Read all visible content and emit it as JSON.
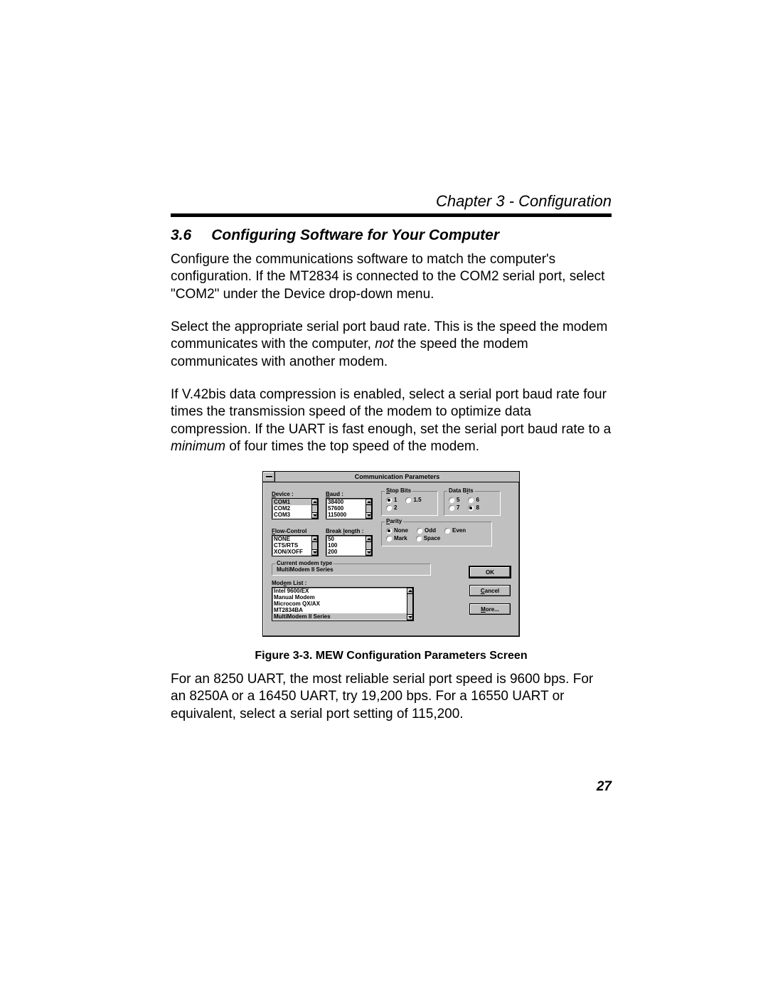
{
  "header": {
    "chapter": "Chapter 3 - Configuration"
  },
  "section": {
    "num": "3.6",
    "title": "Configuring Software for Your Computer"
  },
  "paragraphs": {
    "p1": "Configure the communications software to match the computer's configuration. If the MT2834 is connected to the COM2 serial port, select \"COM2\" under the Device drop-down menu.",
    "p2a": "Select the appropriate serial port baud rate. This is the speed the modem communicates with the computer, ",
    "p2_not": "not",
    "p2b": " the speed the modem communicates with another modem.",
    "p3a": "If V.42bis data compression is enabled, select a serial port baud rate four times the transmission speed of the modem to optimize data compression. If the UART is fast enough, set the serial port baud rate to a ",
    "p3_min": "minimum",
    "p3b": " of four times the top speed of the modem.",
    "p4": "For an 8250 UART, the most reliable serial port speed is 9600 bps. For an 8250A or a 16450 UART, try 19,200 bps. For a 16550 UART or equivalent, select a serial port setting of 115,200."
  },
  "figure": {
    "caption": "Figure 3-3. MEW Configuration Parameters Screen"
  },
  "dialog": {
    "title": "Communication Parameters",
    "device": {
      "label": "Device :",
      "items": [
        "COM1",
        "COM2",
        "COM3"
      ],
      "selected": "COM1"
    },
    "baud": {
      "label": "Baud :",
      "items": [
        "38400",
        "57600",
        "115000"
      ]
    },
    "flow": {
      "label": "Flow-Control",
      "items": [
        "NONE",
        "CTS/RTS",
        "XON/XOFF"
      ]
    },
    "breaklen": {
      "label": "Break length :",
      "items": [
        "50",
        "100",
        "200"
      ]
    },
    "stopbits": {
      "label": "Stop Bits",
      "options": [
        "1",
        "1.5",
        "2"
      ],
      "selected": "1"
    },
    "databits": {
      "label": "Data Bits",
      "options": [
        "5",
        "6",
        "7",
        "8"
      ],
      "selected": "8"
    },
    "parity": {
      "label": "Parity",
      "options": [
        "None",
        "Odd",
        "Even",
        "Mark",
        "Space"
      ],
      "selected": "None"
    },
    "currentmodem": {
      "label": "Current modem type",
      "value": "MultiModem II Series"
    },
    "modemlist": {
      "label": "Modem List :",
      "items": [
        "Intel 9600/EX",
        "Manual Modem",
        "Microcom QX/AX",
        "MT2834BA",
        "MultiModem II Series"
      ],
      "selected": "MultiModem II Series"
    },
    "buttons": {
      "ok": "OK",
      "cancel": "Cancel",
      "more": "More..."
    }
  },
  "page_number": "27"
}
